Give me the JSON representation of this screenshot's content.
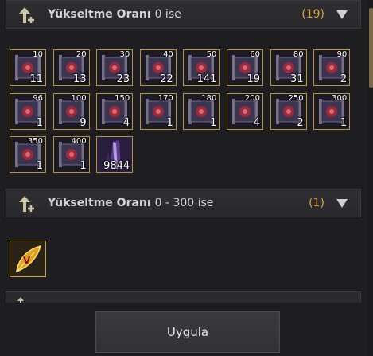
{
  "sections": [
    {
      "title": "Yükseltme Oranı",
      "range": "0 ise",
      "count": "(19)"
    },
    {
      "title": "Yükseltme Oranı",
      "range": "0 - 300 ise",
      "count": "(1)"
    }
  ],
  "items": [
    {
      "level": "10",
      "qty": "11"
    },
    {
      "level": "20",
      "qty": "13"
    },
    {
      "level": "30",
      "qty": "23"
    },
    {
      "level": "40",
      "qty": "22"
    },
    {
      "level": "50",
      "qty": "141"
    },
    {
      "level": "60",
      "qty": "19"
    },
    {
      "level": "80",
      "qty": "31"
    },
    {
      "level": "90",
      "qty": "2"
    },
    {
      "level": "96",
      "qty": "1"
    },
    {
      "level": "100",
      "qty": "9"
    },
    {
      "level": "150",
      "qty": "4"
    },
    {
      "level": "170",
      "qty": "1"
    },
    {
      "level": "180",
      "qty": "1"
    },
    {
      "level": "200",
      "qty": "4"
    },
    {
      "level": "250",
      "qty": "2"
    },
    {
      "level": "300",
      "qty": "1"
    },
    {
      "level": "350",
      "qty": "1"
    },
    {
      "level": "400",
      "qty": "1"
    },
    {
      "level": "",
      "qty": "9844"
    }
  ],
  "section2_items": [
    {
      "icon": "gold-feather-v-icon"
    }
  ],
  "apply_label": "Uygula",
  "colors": {
    "accent": "#d9a437",
    "item_border": "#b69340"
  }
}
